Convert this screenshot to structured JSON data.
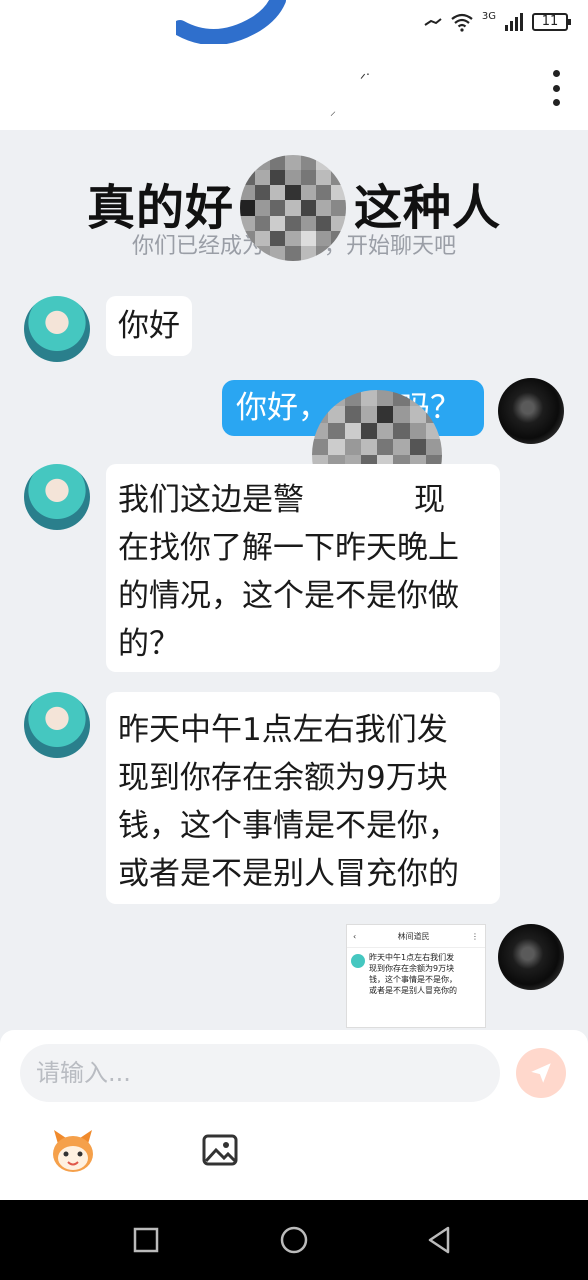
{
  "status_bar": {
    "network": "3G",
    "battery": "11"
  },
  "overlay_title": "真的好",
  "overlay_title_suffix": "这种人",
  "system_message": "你们已经成为",
  "system_message_suffix": "，开始聊天吧",
  "messages": [
    {
      "side": "left",
      "text": "你好"
    },
    {
      "side": "right",
      "text": "你好，",
      "text_suffix": "吗？"
    },
    {
      "side": "left",
      "lines": [
        "我们这边是警",
        "在找你了解一下昨天晚上",
        "的情况，这个是不是你做",
        "的？"
      ],
      "line1_suffix": "现"
    },
    {
      "side": "left",
      "lines": [
        "昨天中午1点左右我们发",
        "现到你存在余额为9万块",
        "钱，这个事情是不是你，",
        "或者是不是别人冒充你的"
      ]
    }
  ],
  "thumbnail": {
    "header_title": "林间道民",
    "body_lines": [
      "昨天中午1点左右我们发",
      "现到你存在余额为9万块",
      "钱，这个事情是不是你，",
      "或者是不是别人冒充你的"
    ]
  },
  "input": {
    "placeholder": "请输入..."
  },
  "icons": {
    "send": "send-icon",
    "emoji": "emoji-icon",
    "image": "image-icon",
    "more": "more-icon"
  },
  "colors": {
    "bubble_right": "#2aa6f2",
    "send_button": "#ffd8cc",
    "background": "#eef0f3"
  }
}
